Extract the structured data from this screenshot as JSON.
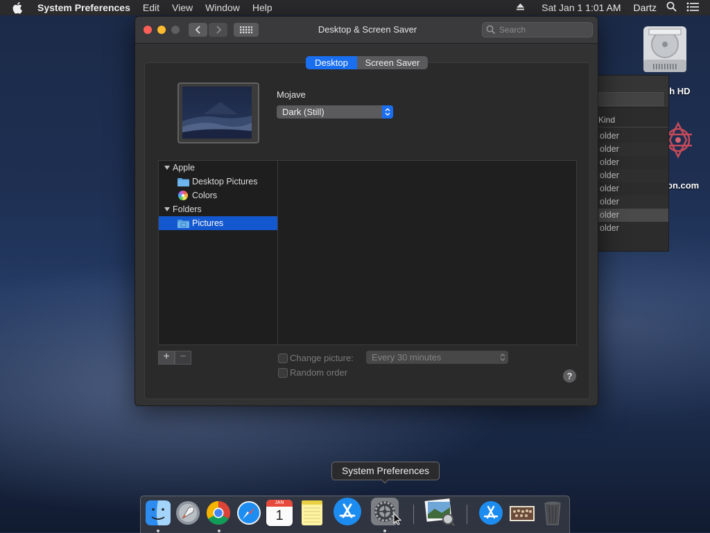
{
  "menubar": {
    "app_name": "System Preferences",
    "items": [
      "Edit",
      "View",
      "Window",
      "Help"
    ],
    "clock": "Sat Jan 1  1:01 AM",
    "user": "Dartz"
  },
  "window": {
    "title": "Desktop & Screen Saver",
    "search_placeholder": "Search",
    "tabs": [
      {
        "label": "Desktop",
        "selected": true
      },
      {
        "label": "Screen Saver",
        "selected": false
      }
    ],
    "wallpaper_name": "Mojave",
    "wallpaper_style": "Dark (Still)",
    "sources": {
      "group_apple": "Apple",
      "desktop_pictures": "Desktop Pictures",
      "colors": "Colors",
      "group_folders": "Folders",
      "pictures": "Pictures"
    },
    "add_button": "+",
    "remove_button": "−",
    "change_picture_label": "Change picture:",
    "change_interval": "Every 30 minutes",
    "random_order_label": "Random order",
    "help_label": "?"
  },
  "background_finder": {
    "column_header": "Kind",
    "rows": [
      "older",
      "older",
      "older",
      "older",
      "older",
      "older",
      "older",
      "older"
    ]
  },
  "desktop": {
    "disk_label": "sh HD",
    "site_label": "on.com"
  },
  "dock": {
    "tooltip": "System Preferences",
    "calendar_month": "JAN",
    "calendar_day": "1"
  },
  "colors": {
    "accent": "#1458cf",
    "traffic_close": "#fe5f57",
    "traffic_minimize": "#febc2e",
    "traffic_zoom": "#5f5f5f"
  }
}
